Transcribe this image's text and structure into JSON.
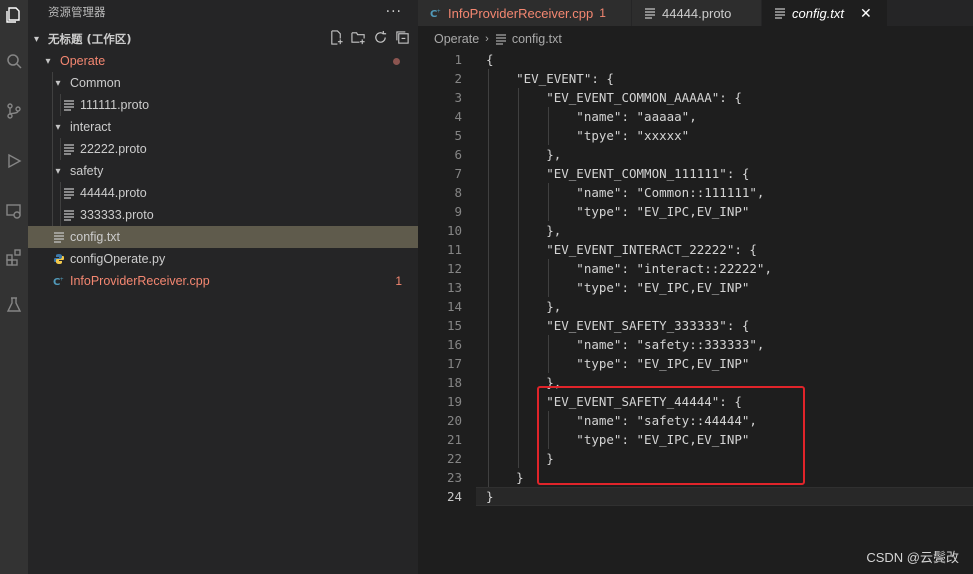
{
  "explorer": {
    "title": "资源管理器",
    "more": "···",
    "workspace": "无标题 (工作区)",
    "tree": [
      {
        "label": "Operate",
        "kind": "folder",
        "modified": true
      },
      {
        "label": "Common",
        "kind": "folder"
      },
      {
        "label": "111111.proto",
        "kind": "file"
      },
      {
        "label": "interact",
        "kind": "folder"
      },
      {
        "label": "22222.proto",
        "kind": "file"
      },
      {
        "label": "safety",
        "kind": "folder"
      },
      {
        "label": "44444.proto",
        "kind": "file"
      },
      {
        "label": "333333.proto",
        "kind": "file"
      },
      {
        "label": "config.txt",
        "kind": "file",
        "selected": true
      },
      {
        "label": "configOperate.py",
        "kind": "python"
      },
      {
        "label": "InfoProviderReceiver.cpp",
        "kind": "cpp",
        "badge": "1"
      }
    ]
  },
  "tabs": [
    {
      "label": "InfoProviderReceiver.cpp",
      "badge": "1"
    },
    {
      "label": "44444.proto"
    },
    {
      "label": "config.txt",
      "close": "✕"
    }
  ],
  "breadcrumb": {
    "folder": "Operate",
    "sep": "›",
    "file": "config.txt"
  },
  "editor": {
    "line_numbers": [
      "1",
      "2",
      "3",
      "4",
      "5",
      "6",
      "7",
      "8",
      "9",
      "10",
      "11",
      "12",
      "13",
      "14",
      "15",
      "16",
      "17",
      "18",
      "19",
      "20",
      "21",
      "22",
      "23",
      "24"
    ],
    "lines": [
      "{",
      "    \"EV_EVENT\": {",
      "        \"EV_EVENT_COMMON_AAAAA\": {",
      "            \"name\": \"aaaaa\",",
      "            \"tpye\": \"xxxxx\"",
      "        },",
      "        \"EV_EVENT_COMMON_111111\": {",
      "            \"name\": \"Common::111111\",",
      "            \"type\": \"EV_IPC,EV_INP\"",
      "        },",
      "        \"EV_EVENT_INTERACT_22222\": {",
      "            \"name\": \"interact::22222\",",
      "            \"type\": \"EV_IPC,EV_INP\"",
      "        },",
      "        \"EV_EVENT_SAFETY_333333\": {",
      "            \"name\": \"safety::333333\",",
      "            \"type\": \"EV_IPC,EV_INP\"",
      "        },",
      "        \"EV_EVENT_SAFETY_44444\": {",
      "            \"name\": \"safety::44444\",",
      "            \"type\": \"EV_IPC,EV_INP\"",
      "        }",
      "    }",
      "}"
    ],
    "current_line": 24
  },
  "watermark": "CSDN @云鬓改",
  "colors": {
    "error": "#f48771",
    "highlight_box": "#e0242a",
    "selection": "#5f5b4c"
  }
}
